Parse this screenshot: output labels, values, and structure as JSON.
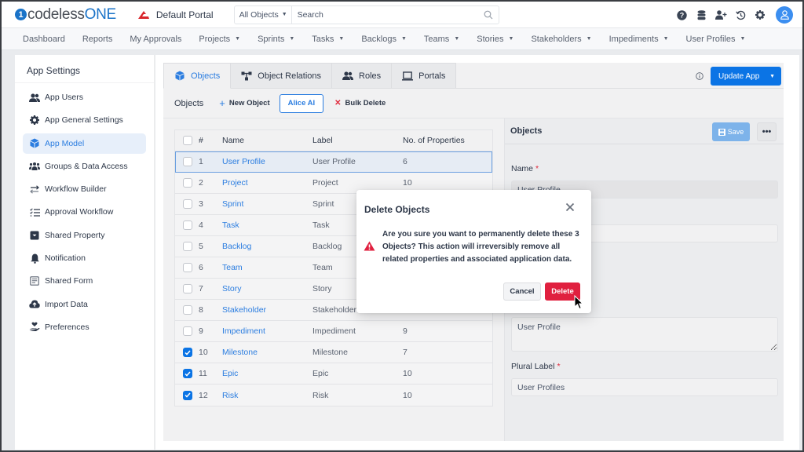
{
  "header": {
    "logo_prefix": "codeless",
    "logo_suffix": "ONE",
    "portal_name": "Default Portal",
    "search_scope": "All Objects",
    "search_placeholder": "Search",
    "icons": [
      "help-icon",
      "database-icon",
      "add-user-icon",
      "history-icon",
      "gear-icon",
      "user-avatar"
    ]
  },
  "nav": {
    "items": [
      {
        "label": "Dashboard",
        "dropdown": false
      },
      {
        "label": "Reports",
        "dropdown": false
      },
      {
        "label": "My Approvals",
        "dropdown": false
      },
      {
        "label": "Projects",
        "dropdown": true
      },
      {
        "label": "Sprints",
        "dropdown": true
      },
      {
        "label": "Tasks",
        "dropdown": true
      },
      {
        "label": "Backlogs",
        "dropdown": true
      },
      {
        "label": "Teams",
        "dropdown": true
      },
      {
        "label": "Stories",
        "dropdown": true
      },
      {
        "label": "Stakeholders",
        "dropdown": true
      },
      {
        "label": "Impediments",
        "dropdown": true
      },
      {
        "label": "User Profiles",
        "dropdown": true
      }
    ]
  },
  "sidebar": {
    "title": "App Settings",
    "items": [
      {
        "label": "App Users",
        "icon": "users-icon"
      },
      {
        "label": "App General Settings",
        "icon": "gear-icon"
      },
      {
        "label": "App Model",
        "icon": "cube-icon",
        "active": true
      },
      {
        "label": "Groups & Data Access",
        "icon": "groups-icon"
      },
      {
        "label": "Workflow Builder",
        "icon": "arrows-exchange-icon"
      },
      {
        "label": "Approval Workflow",
        "icon": "checklist-icon"
      },
      {
        "label": "Shared Property",
        "icon": "inbox-icon"
      },
      {
        "label": "Notification",
        "icon": "bell-icon"
      },
      {
        "label": "Shared Form",
        "icon": "form-icon"
      },
      {
        "label": "Import Data",
        "icon": "cloud-upload-icon"
      },
      {
        "label": "Preferences",
        "icon": "hand-heart-icon"
      }
    ]
  },
  "tabs": [
    {
      "label": "Objects",
      "active": true
    },
    {
      "label": "Object Relations"
    },
    {
      "label": "Roles"
    },
    {
      "label": "Portals"
    }
  ],
  "update_app_label": "Update App",
  "toolbar": {
    "title": "Objects",
    "new_object_label": "New Object",
    "alice_label": "Alice AI",
    "bulk_delete_label": "Bulk Delete"
  },
  "table": {
    "columns": [
      "#",
      "Name",
      "Label",
      "No. of Properties"
    ],
    "rows": [
      {
        "num": "1",
        "name": "User Profile",
        "label": "User Profile",
        "props": "6",
        "checked": false,
        "highlight": true
      },
      {
        "num": "2",
        "name": "Project",
        "label": "Project",
        "props": "10",
        "checked": false
      },
      {
        "num": "3",
        "name": "Sprint",
        "label": "Sprint",
        "props": "",
        "checked": false
      },
      {
        "num": "4",
        "name": "Task",
        "label": "Task",
        "props": "",
        "checked": false
      },
      {
        "num": "5",
        "name": "Backlog",
        "label": "Backlog",
        "props": "",
        "checked": false
      },
      {
        "num": "6",
        "name": "Team",
        "label": "Team",
        "props": "",
        "checked": false
      },
      {
        "num": "7",
        "name": "Story",
        "label": "Story",
        "props": "",
        "checked": false
      },
      {
        "num": "8",
        "name": "Stakeholder",
        "label": "Stakeholder",
        "props": "",
        "checked": false
      },
      {
        "num": "9",
        "name": "Impediment",
        "label": "Impediment",
        "props": "9",
        "checked": false
      },
      {
        "num": "10",
        "name": "Milestone",
        "label": "Milestone",
        "props": "7",
        "checked": true
      },
      {
        "num": "11",
        "name": "Epic",
        "label": "Epic",
        "props": "10",
        "checked": true
      },
      {
        "num": "12",
        "name": "Risk",
        "label": "Risk",
        "props": "10",
        "checked": true
      }
    ]
  },
  "details": {
    "title": "Objects",
    "save_label": "Save",
    "more_label": "•••",
    "name_label": "Name",
    "name_value": "User Profile",
    "second_value": "",
    "textarea_value": "User Profile",
    "plural_label": "Plural Label",
    "plural_value": "User Profiles"
  },
  "modal": {
    "title": "Delete Objects",
    "message": "Are you sure you want to permanently delete these 3 Objects? This action will irreversibly remove all related properties and associated application data.",
    "cancel_label": "Cancel",
    "delete_label": "Delete"
  },
  "colors": {
    "accent": "#0b74e5",
    "link": "#2b7de0",
    "danger": "#e0203f"
  }
}
